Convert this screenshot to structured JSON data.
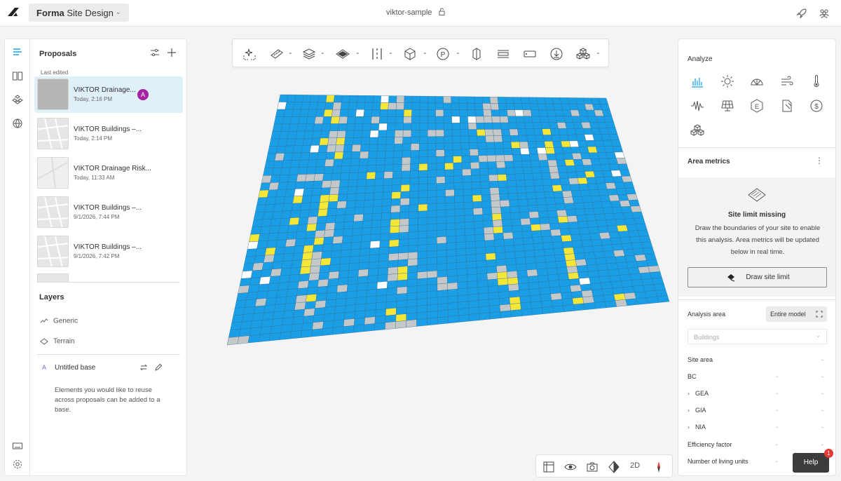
{
  "header": {
    "app_name_bold": "Forma",
    "app_name_rest": "Site Design",
    "project_title": "viktor-sample"
  },
  "proposals": {
    "title": "Proposals",
    "section_label": "Last edited",
    "items": [
      {
        "name": "VIKTOR Drainage...",
        "time": "Today, 2:16 PM",
        "badge": "A",
        "selected": true
      },
      {
        "name": "VIKTOR Buildings –...",
        "time": "Today, 2:14 PM"
      },
      {
        "name": "VIKTOR Drainage Risk...",
        "time": "Today, 11:33 AM"
      },
      {
        "name": "VIKTOR Buildings –...",
        "time": "9/1/2026, 7:44 PM"
      },
      {
        "name": "VIKTOR Buildings –...",
        "time": "9/1/2026, 7:42 PM"
      }
    ]
  },
  "layers": {
    "title": "Layers",
    "items": [
      "Generic",
      "Terrain"
    ],
    "base_badge": "A",
    "base_name": "Untitled base",
    "base_note": "Elements you would like to reuse across proposals can be added to a base."
  },
  "analyze": {
    "title": "Analyze",
    "icons": [
      "bar-chart-icon",
      "sun-icon",
      "sky-dome-icon",
      "wind-icon",
      "thermometer-icon",
      "noise-icon",
      "solar-panel-icon",
      "energy-icon",
      "daylight-icon",
      "cost-icon",
      "volumes-icon"
    ]
  },
  "area_metrics": {
    "title": "Area metrics",
    "missing_title": "Site limit missing",
    "missing_text": "Draw the boundaries of your site to enable this analysis. Area metrics will be updated below in real time.",
    "draw_button": "Draw site limit",
    "analysis_area_label": "Analysis area",
    "analysis_area_value": "Entire model",
    "dropdown_placeholder": "Buildings",
    "site_area": "Site area",
    "site_area_value": "-",
    "rows": [
      {
        "label": "BC",
        "v1": "-",
        "v2": "-",
        "expandable": false
      },
      {
        "label": "GEA",
        "v1": "-",
        "v2": "-",
        "expandable": true
      },
      {
        "label": "GIA",
        "v1": "-",
        "v2": "-",
        "expandable": true
      },
      {
        "label": "NIA",
        "v1": "-",
        "v2": "-",
        "expandable": true
      },
      {
        "label": "Efficiency factor",
        "v1": "-",
        "v2": "-",
        "expandable": false
      },
      {
        "label": "Number of living units",
        "v1": "-",
        "v2": "-",
        "expandable": false
      }
    ]
  },
  "bottom_toolbar": {
    "mode_label": "2D"
  },
  "help": {
    "label": "Help",
    "count": "1"
  },
  "colors": {
    "accent": "#1aa3e8",
    "selected_bg": "#dff0f9",
    "badge": "#a622a4",
    "analysis_blue": "#1a9fe6",
    "analysis_yellow": "#f5e63a",
    "analysis_gray": "#c5c8c9"
  }
}
